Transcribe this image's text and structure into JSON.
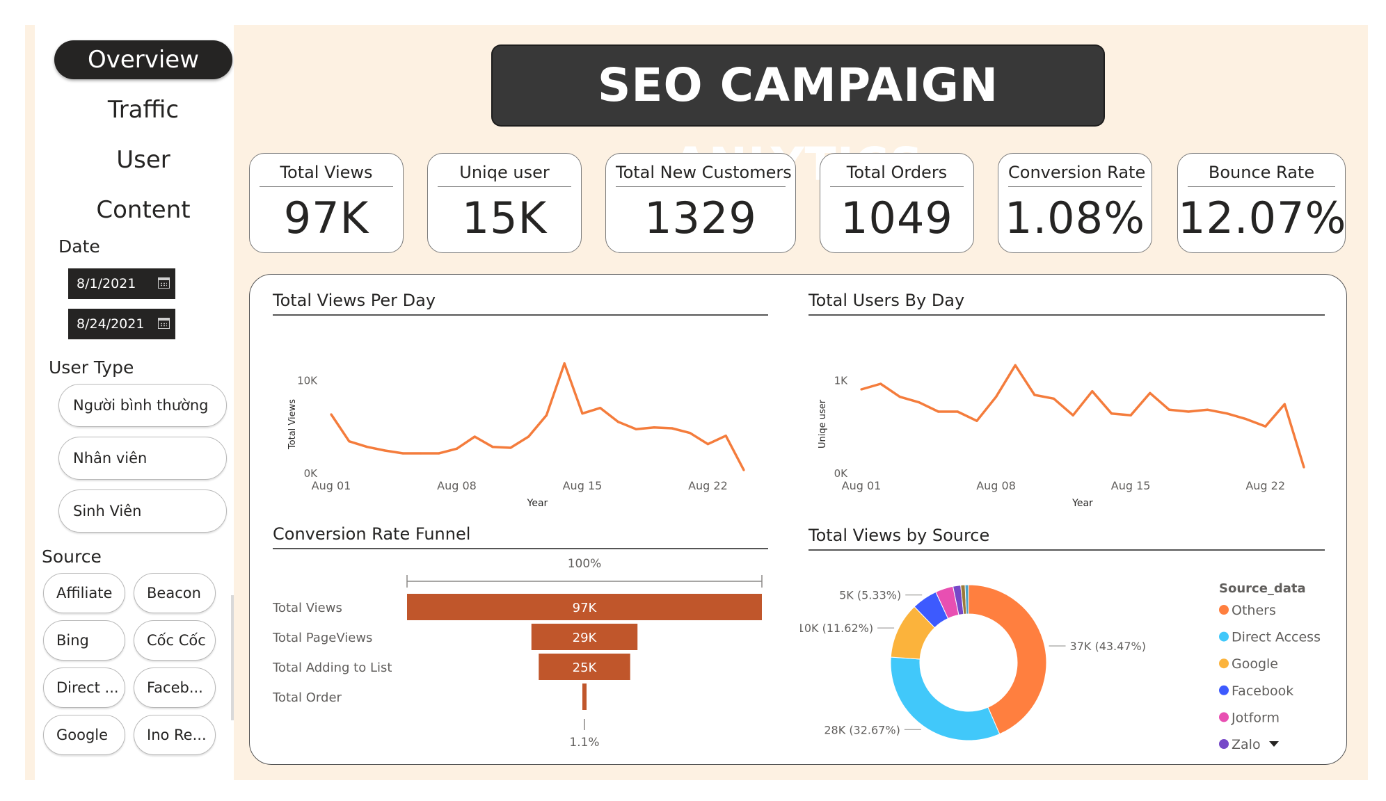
{
  "nav": {
    "items": [
      {
        "label": "Overview"
      },
      {
        "label": "Traffic"
      },
      {
        "label": "User"
      },
      {
        "label": "Content"
      }
    ]
  },
  "filters": {
    "date_label": "Date",
    "date_start": "8/1/2021",
    "date_end": "8/24/2021",
    "user_type_label": "User Type",
    "user_types": [
      "Người bình thường",
      "Nhân viên",
      "Sinh Viên"
    ],
    "source_label": "Source",
    "sources": [
      "Affiliate",
      "Beacon",
      "Bing",
      "Cốc Cốc",
      "Direct ...",
      "Faceb...",
      "Google",
      "Ino Re..."
    ]
  },
  "header": {
    "title": "SEO CAMPAIGN ANLYTICS"
  },
  "kpis": [
    {
      "label": "Total Views",
      "value": "97K"
    },
    {
      "label": "Uniqe user",
      "value": "15K"
    },
    {
      "label": "Total New Customers",
      "value": "1329"
    },
    {
      "label": "Total Orders",
      "value": "1049"
    },
    {
      "label": "Conversion Rate",
      "value": "1.08%"
    },
    {
      "label": "Bounce Rate",
      "value": "12.07%"
    }
  ],
  "colors": {
    "line": "#f47c3c",
    "funnel": "#c0562b",
    "title_bg": "#383838",
    "page_bg": "#fdf1e2"
  },
  "chart_data": [
    {
      "type": "line",
      "title": "Total Views Per Day",
      "xlabel": "Year",
      "ylabel": "Total Views",
      "x_tick_labels": [
        "Aug 01",
        "Aug 08",
        "Aug 15",
        "Aug 22"
      ],
      "y_tick_labels": [
        "0K",
        "10K"
      ],
      "ylim": [
        0,
        12000
      ],
      "x": [
        "2021-08-01",
        "2021-08-02",
        "2021-08-03",
        "2021-08-04",
        "2021-08-05",
        "2021-08-06",
        "2021-08-07",
        "2021-08-08",
        "2021-08-09",
        "2021-08-10",
        "2021-08-11",
        "2021-08-12",
        "2021-08-13",
        "2021-08-14",
        "2021-08-15",
        "2021-08-16",
        "2021-08-17",
        "2021-08-18",
        "2021-08-19",
        "2021-08-20",
        "2021-08-21",
        "2021-08-22",
        "2021-08-23",
        "2021-08-24"
      ],
      "values": [
        6300,
        3400,
        2800,
        2400,
        2100,
        2100,
        2100,
        2600,
        3900,
        2800,
        2700,
        3900,
        6200,
        11800,
        6400,
        7000,
        5500,
        4700,
        4900,
        4800,
        4300,
        3100,
        4000,
        300
      ]
    },
    {
      "type": "line",
      "title": "Total Users By Day",
      "xlabel": "Year",
      "ylabel": "Uniqe user",
      "x_tick_labels": [
        "Aug 01",
        "Aug 08",
        "Aug 15",
        "Aug 22"
      ],
      "y_tick_labels": [
        "0K",
        "1K"
      ],
      "ylim": [
        0,
        1200
      ],
      "x": [
        "2021-08-01",
        "2021-08-02",
        "2021-08-03",
        "2021-08-04",
        "2021-08-05",
        "2021-08-06",
        "2021-08-07",
        "2021-08-08",
        "2021-08-09",
        "2021-08-10",
        "2021-08-11",
        "2021-08-12",
        "2021-08-13",
        "2021-08-14",
        "2021-08-15",
        "2021-08-16",
        "2021-08-17",
        "2021-08-18",
        "2021-08-19",
        "2021-08-20",
        "2021-08-21",
        "2021-08-22",
        "2021-08-23",
        "2021-08-24"
      ],
      "values": [
        900,
        960,
        820,
        760,
        660,
        660,
        560,
        820,
        1160,
        840,
        800,
        620,
        880,
        640,
        620,
        860,
        680,
        660,
        680,
        640,
        580,
        500,
        740,
        60
      ]
    },
    {
      "type": "bar",
      "subtype": "funnel",
      "title": "Conversion Rate Funnel",
      "categories": [
        "Total Views",
        "Total PageViews",
        "Total Adding to List",
        "Total Order"
      ],
      "values": [
        97000,
        29000,
        25000,
        1049
      ],
      "data_labels": [
        "97K",
        "29K",
        "25K",
        ""
      ],
      "top_label": "100%",
      "bottom_label": "1.1%"
    },
    {
      "type": "pie",
      "subtype": "donut",
      "title": "Total Views by Source",
      "legend_title": "Source_data",
      "legend_position": "right",
      "series": [
        {
          "name": "Others",
          "value": 43.47,
          "label": "37K (43.47%)",
          "color": "#ff7f3f"
        },
        {
          "name": "Direct Access",
          "value": 32.67,
          "label": "28K (32.67%)",
          "color": "#41c8fa"
        },
        {
          "name": "Google",
          "value": 11.62,
          "label": "10K (11.62%)",
          "color": "#fbb33c"
        },
        {
          "name": "Facebook",
          "value": 5.33,
          "label": "5K (5.33%)",
          "color": "#3d5afe"
        },
        {
          "name": "Jotform",
          "value": 3.7,
          "label": "",
          "color": "#e84fb2"
        },
        {
          "name": "Zalo",
          "value": 1.6,
          "label": "",
          "color": "#7648c8"
        },
        {
          "name": "",
          "value": 0.9,
          "label": "",
          "color": "#9b7a3a"
        },
        {
          "name": "",
          "value": 0.71,
          "label": "",
          "color": "#4aa3c8"
        }
      ]
    }
  ]
}
